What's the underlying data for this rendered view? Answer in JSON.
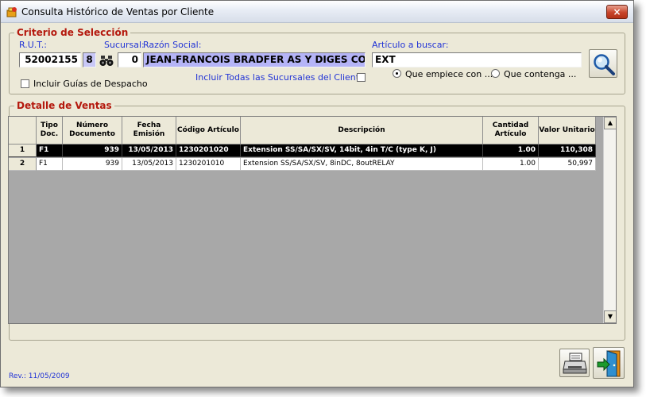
{
  "window": {
    "title": "Consulta Histórico de Ventas por Cliente",
    "close_label": "×"
  },
  "criterio": {
    "legend": "Criterio de Selección",
    "rut_label": "R.U.T.:",
    "rut_value": "52002155",
    "rut_dv": "8",
    "sucursal_label": "Sucursal:",
    "sucursal_value": "0",
    "razon_label": "Razón Social:",
    "razon_value": "JEAN-FRANCOIS BRADFER AS Y DIGES CONSULTORES EIRL",
    "articulo_label": "Artículo a buscar:",
    "articulo_value": "EXT",
    "guias_label": "Incluir Guías de Despacho",
    "sucursales_label": "Incluir Todas las Sucursales del Cliente",
    "radio_empiece": "Que empiece con ...",
    "radio_contenga": "Que contenga ..."
  },
  "detalle": {
    "legend": "Detalle de Ventas",
    "columns": [
      {
        "label": "",
        "key": "num"
      },
      {
        "label": "Tipo Doc.",
        "key": "tipo"
      },
      {
        "label": "Número Documento",
        "key": "numero"
      },
      {
        "label": "Fecha Emisión",
        "key": "fecha"
      },
      {
        "label": "Código Artículo",
        "key": "codigo"
      },
      {
        "label": "Descripción",
        "key": "desc"
      },
      {
        "label": "Cantidad Artículo",
        "key": "cantidad"
      },
      {
        "label": "Valor Unitario",
        "key": "valor"
      }
    ],
    "rows": [
      {
        "num": "1",
        "tipo": "F1",
        "numero": "939",
        "fecha": "13/05/2013",
        "codigo": "1230201020",
        "desc": "Extension SS/SA/SX/SV, 14bit, 4in T/C (type K, J)",
        "cantidad": "1.00",
        "valor": "110,308",
        "selected": true
      },
      {
        "num": "2",
        "tipo": "F1",
        "numero": "939",
        "fecha": "13/05/2013",
        "codigo": "1230201010",
        "desc": "Extension SS/SA/SX/SV, 8inDC, 8outRELAY",
        "cantidad": "1.00",
        "valor": "50,997",
        "selected": false
      }
    ]
  },
  "footer": {
    "rev": "Rev.: 11/05/2009"
  },
  "icons": [
    "app-icon",
    "binoculars-icon",
    "magnifier-icon",
    "printer-icon",
    "exit-door-icon"
  ]
}
